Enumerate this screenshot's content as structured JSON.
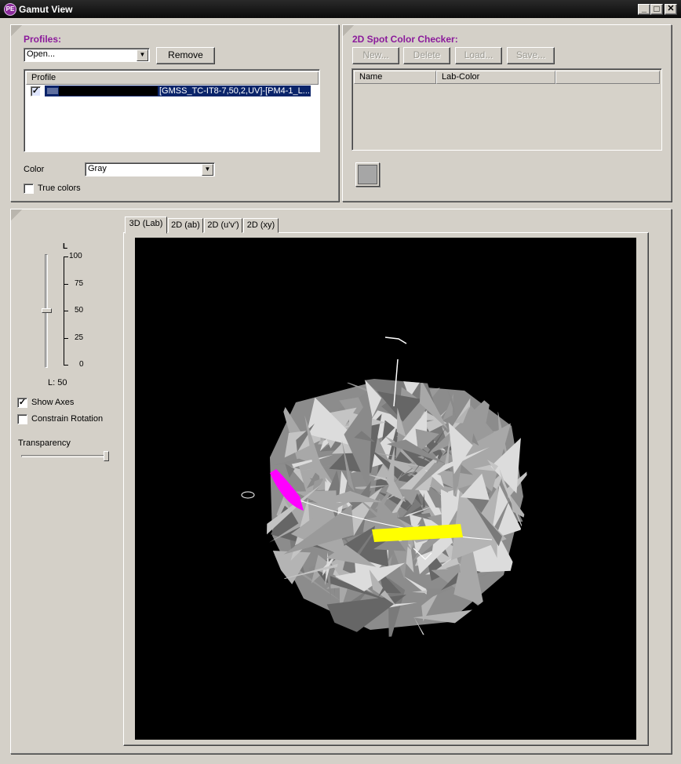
{
  "window": {
    "title": "Gamut View",
    "icon_label": "PE",
    "minimize_glyph": "_",
    "maximize_glyph": "□",
    "close_glyph": "✕"
  },
  "profiles": {
    "title": "Profiles:",
    "open_combo_value": "Open...",
    "remove_label": "Remove",
    "list_header": "Profile",
    "items": [
      {
        "checked": true,
        "name": "[GMSS_TC-IT8-7,50,2,UV]-[PM4-1_L..."
      }
    ],
    "color_label": "Color",
    "color_value": "Gray",
    "true_colors_label": "True colors",
    "true_colors_checked": false
  },
  "spot_checker": {
    "title": "2D Spot Color Checker:",
    "buttons": {
      "new": "New...",
      "delete": "Delete",
      "load": "Load...",
      "save": "Save..."
    },
    "columns": {
      "name": "Name",
      "lab": "Lab-Color"
    },
    "swatch_color": "#a6a6a6"
  },
  "view_controls": {
    "slider_title": "L",
    "ticks": [
      "100",
      "75",
      "50",
      "25",
      "0"
    ],
    "l_value_text": "L: 50",
    "l_value": 50,
    "show_axes_label": "Show Axes",
    "show_axes_checked": true,
    "constrain_rotation_label": "Constrain Rotation",
    "constrain_rotation_checked": false,
    "transparency_label": "Transparency",
    "transparency_value": 1.0
  },
  "tabs": [
    "3D (Lab)",
    "2D (ab)",
    "2D (u'v')",
    "2D (xy)"
  ],
  "active_tab": 0,
  "colors": {
    "accent_title": "#8b1a9b",
    "selection": "#0a246a",
    "viewport_bg": "#000000",
    "gamut_gray": "#9a9a9a",
    "magenta": "#ff00ff",
    "yellow": "#ffff00"
  },
  "icons": {
    "dropdown": "chevron-down-icon",
    "check": "checkmark-icon"
  }
}
